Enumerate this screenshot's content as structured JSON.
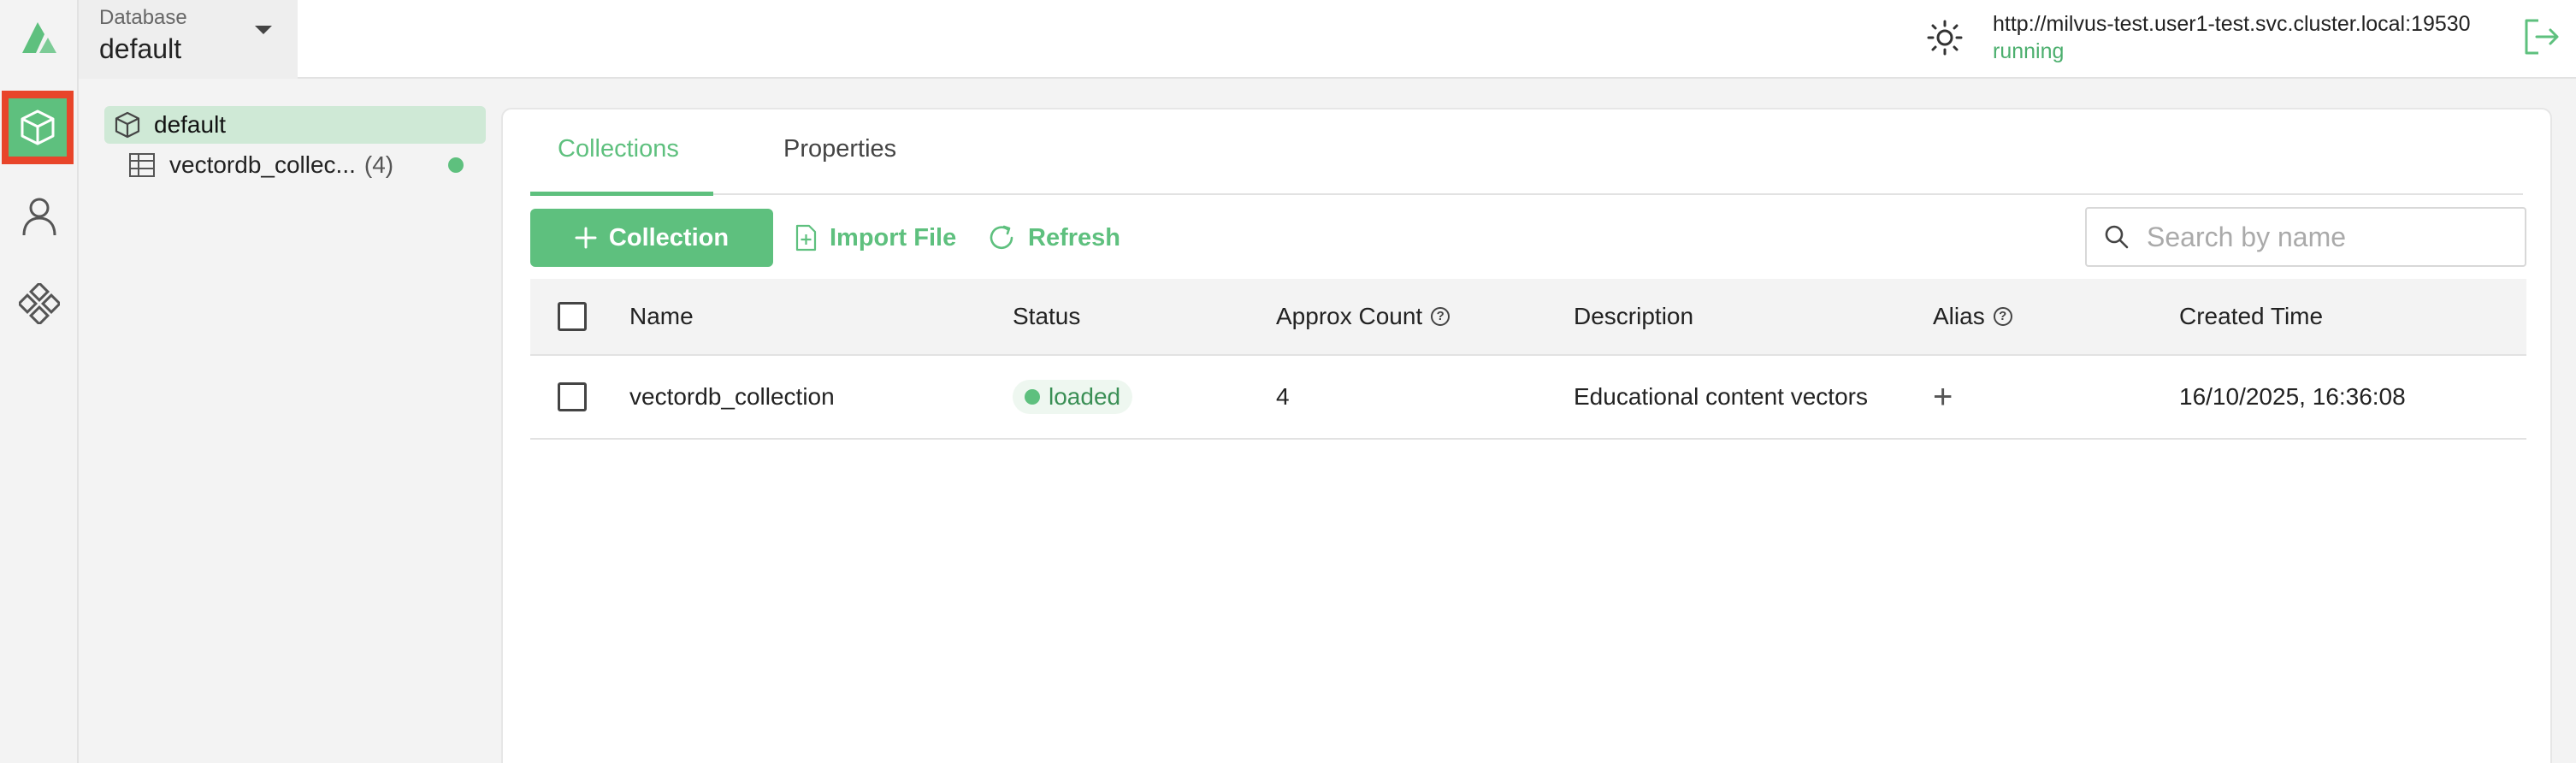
{
  "topbar": {
    "db_label": "Database",
    "db_value": "default",
    "connection_url": "http://milvus-test.user1-test.svc.cluster.local:19530",
    "connection_status": "running"
  },
  "nav": {
    "items": [
      "database-icon",
      "user-icon",
      "plugins-icon"
    ]
  },
  "tree": {
    "database": "default",
    "collection": {
      "label": "vectordb_collec...",
      "count": "(4)"
    }
  },
  "tabs": [
    {
      "label": "Collections"
    },
    {
      "label": "Properties"
    }
  ],
  "toolbar": {
    "collection_label": "Collection",
    "import_label": "Import File",
    "refresh_label": "Refresh",
    "search_placeholder": "Search by name"
  },
  "table": {
    "headers": {
      "name": "Name",
      "status": "Status",
      "approx_count": "Approx Count",
      "description": "Description",
      "alias": "Alias",
      "created_time": "Created Time"
    },
    "rows": [
      {
        "name": "vectordb_collection",
        "status": "loaded",
        "approx_count": "4",
        "description": "Educational content vectors",
        "alias": "+",
        "created_time": "16/10/2025, 16:36:08"
      }
    ]
  },
  "colors": {
    "accent": "#5ec07e",
    "highlight": "#e8452a"
  }
}
